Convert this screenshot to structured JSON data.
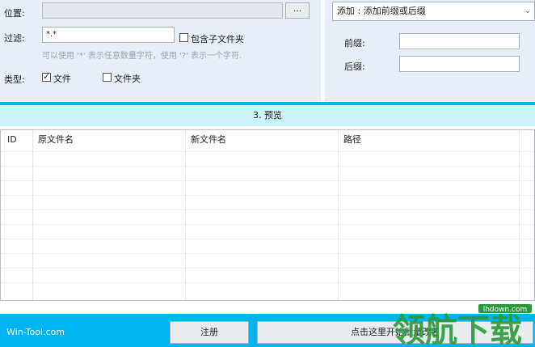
{
  "source": {
    "location_label": "位置:",
    "location_value": "",
    "browse_label": "...",
    "filter_label": "过滤:",
    "filter_value": "*.*",
    "include_subfolders_label": "包含子文件夹",
    "include_subfolders_checked": false,
    "filter_hint": "可以使用 '*' 表示任意数量字符，使用 '?' 表示一个字符.",
    "type_label": "类型:",
    "type_file_label": "文件",
    "type_file_checked": true,
    "type_folder_label": "文件夹",
    "type_folder_checked": false
  },
  "rule": {
    "mode_selected": "添加 : 添加前缀或后缀",
    "prefix_label": "前缀:",
    "prefix_value": "",
    "suffix_label": "后缀:",
    "suffix_value": ""
  },
  "preview": {
    "title": "3. 预览",
    "columns": [
      "ID",
      "原文件名",
      "新文件名",
      "路径"
    ],
    "rows": []
  },
  "footer": {
    "brand": "Win-Tool.com",
    "register_label": "注册",
    "start_label": "点击这里开始批量改名"
  },
  "watermark": {
    "text": "领航下载",
    "site": "lhdown.com"
  },
  "colors": {
    "accent": "#00b4f0",
    "panel_bg": "#e8eef5",
    "preview_header_bg": "#cdf3fb"
  }
}
